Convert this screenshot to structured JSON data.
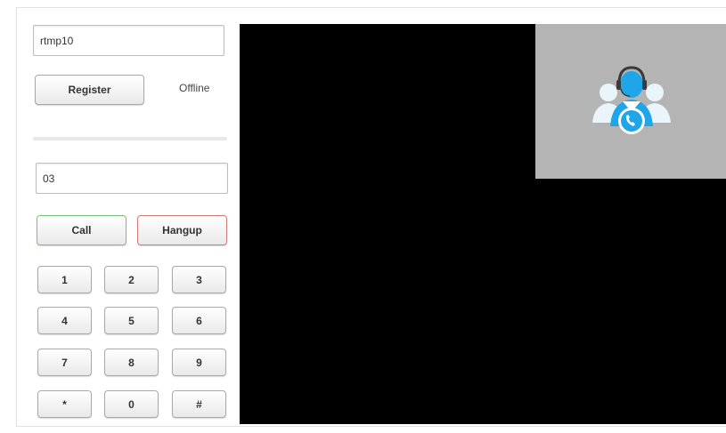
{
  "register": {
    "username_value": "rtmp10",
    "button_label": "Register",
    "status": "Offline"
  },
  "dial": {
    "number_value": "03",
    "call_label": "Call",
    "hangup_label": "Hangup"
  },
  "keypad": {
    "keys": [
      "1",
      "2",
      "3",
      "4",
      "5",
      "6",
      "7",
      "8",
      "9",
      "*",
      "0",
      "#"
    ]
  },
  "video": {
    "placeholder_icon": "support-agent-call-icon"
  },
  "colors": {
    "call_border": "#74c474",
    "hangup_border": "#d27a7a",
    "video_bg": "#000000",
    "preview_bg": "#b4b4b4",
    "agent_icon_blue": "#1fa6e8"
  }
}
